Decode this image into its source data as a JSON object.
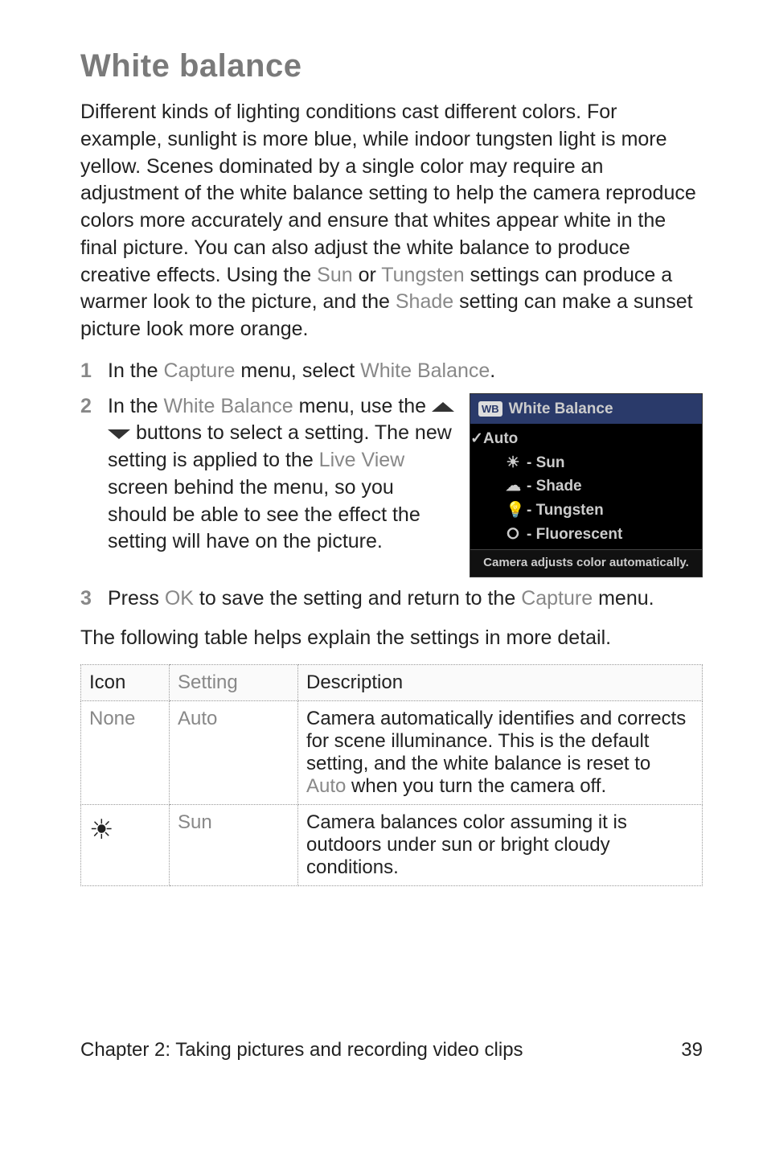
{
  "title": "White balance",
  "intro_parts": {
    "p1": "Different kinds of lighting conditions cast different colors. For example, sunlight is more blue, while indoor tungsten light is more yellow. Scenes dominated by a single color may require an adjustment of the white balance setting to help the camera reproduce colors more accurately and ensure that whites appear white in the final picture. You can also adjust the white balance to produce creative effects. Using the ",
    "sun": "Sun",
    "p2": " or ",
    "tungsten": "Tungsten",
    "p3": " settings can produce a warmer look to the picture, and the ",
    "shade": "Shade",
    "p4": " setting can make a sunset picture look more orange."
  },
  "steps": {
    "s1": {
      "a": "In the ",
      "capture": "Capture",
      "b": " menu, select ",
      "wb": "White Balance",
      "c": "."
    },
    "s2": {
      "a": "In the ",
      "wb": "White Balance",
      "b": " menu, use the ",
      "c": " buttons to select a setting. The new setting is applied to the ",
      "lv": "Live View",
      "d": " screen behind the menu, so you should be able to see the effect the setting will have on the picture."
    },
    "s3": {
      "a": "Press ",
      "ok": "OK",
      "b": " to save the setting and return to the ",
      "capture": "Capture",
      "c": " menu."
    }
  },
  "wb_menu": {
    "badge": "WB",
    "title": "White Balance",
    "items": [
      {
        "label": "Auto",
        "selected": true,
        "icon": ""
      },
      {
        "label": "- Sun",
        "icon": "☀"
      },
      {
        "label": "- Shade",
        "icon": "☁"
      },
      {
        "label": "- Tungsten",
        "icon": "💡"
      },
      {
        "label": "- Fluorescent",
        "icon": "⭘"
      }
    ],
    "footer": "Camera adjusts color automatically."
  },
  "table_lead": "The following table helps explain the settings in more detail.",
  "table": {
    "headers": {
      "icon": "Icon",
      "setting": "Setting",
      "desc": "Description"
    },
    "rows": [
      {
        "icon_text": "None",
        "icon_glyph": "",
        "setting": "Auto",
        "desc_a": "Camera automatically identifies and corrects for scene illuminance. This is the default setting, and the white balance is reset to ",
        "desc_em": "Auto",
        "desc_b": " when you turn the camera off."
      },
      {
        "icon_text": "",
        "icon_glyph": "☀",
        "setting": "Sun",
        "desc_a": "Camera balances color assuming it is outdoors under sun or bright cloudy conditions.",
        "desc_em": "",
        "desc_b": ""
      }
    ]
  },
  "footer": {
    "chapter": "Chapter 2: Taking pictures and recording video clips",
    "page": "39"
  }
}
